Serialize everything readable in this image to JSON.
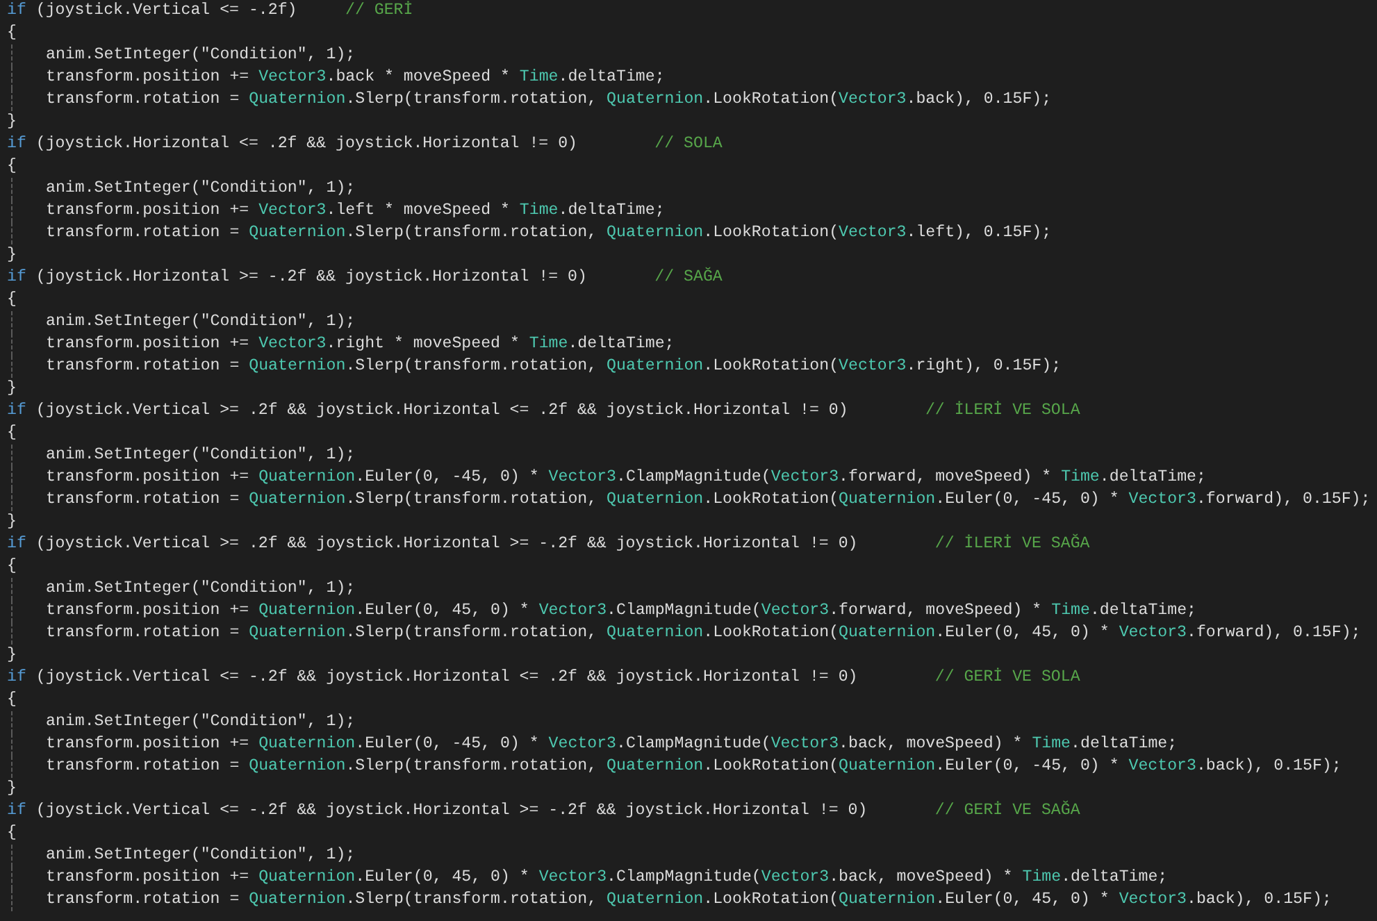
{
  "editor": {
    "lines": [
      {
        "indented": false,
        "tokens": [
          {
            "text": "if",
            "kind": "keyword"
          },
          {
            "text": " (joystick.Vertical <= -.2f)     ",
            "kind": "plain"
          },
          {
            "text": "// GERİ",
            "kind": "comment"
          }
        ]
      },
      {
        "indented": false,
        "tokens": [
          {
            "text": "{",
            "kind": "plain"
          }
        ]
      },
      {
        "indented": true,
        "tokens": [
          {
            "text": "anim.SetInteger(\"Condition\", 1);",
            "kind": "plain"
          }
        ]
      },
      {
        "indented": true,
        "tokens": [
          {
            "text": "transform.position += ",
            "kind": "plain"
          },
          {
            "text": "Vector3",
            "kind": "type"
          },
          {
            "text": ".back * moveSpeed * ",
            "kind": "plain"
          },
          {
            "text": "Time",
            "kind": "type"
          },
          {
            "text": ".deltaTime;",
            "kind": "plain"
          }
        ]
      },
      {
        "indented": true,
        "tokens": [
          {
            "text": "transform.rotation = ",
            "kind": "plain"
          },
          {
            "text": "Quaternion",
            "kind": "type"
          },
          {
            "text": ".Slerp(transform.rotation, ",
            "kind": "plain"
          },
          {
            "text": "Quaternion",
            "kind": "type"
          },
          {
            "text": ".LookRotation(",
            "kind": "plain"
          },
          {
            "text": "Vector3",
            "kind": "type"
          },
          {
            "text": ".back), 0.15F);",
            "kind": "plain"
          }
        ]
      },
      {
        "indented": false,
        "tokens": [
          {
            "text": "}",
            "kind": "plain"
          }
        ]
      },
      {
        "indented": false,
        "tokens": [
          {
            "text": "if",
            "kind": "keyword"
          },
          {
            "text": " (joystick.Horizontal <= .2f && joystick.Horizontal != 0)        ",
            "kind": "plain"
          },
          {
            "text": "// SOLA",
            "kind": "comment"
          }
        ]
      },
      {
        "indented": false,
        "tokens": [
          {
            "text": "{",
            "kind": "plain"
          }
        ]
      },
      {
        "indented": true,
        "tokens": [
          {
            "text": "anim.SetInteger(\"Condition\", 1);",
            "kind": "plain"
          }
        ]
      },
      {
        "indented": true,
        "tokens": [
          {
            "text": "transform.position += ",
            "kind": "plain"
          },
          {
            "text": "Vector3",
            "kind": "type"
          },
          {
            "text": ".left * moveSpeed * ",
            "kind": "plain"
          },
          {
            "text": "Time",
            "kind": "type"
          },
          {
            "text": ".deltaTime;",
            "kind": "plain"
          }
        ]
      },
      {
        "indented": true,
        "tokens": [
          {
            "text": "transform.rotation = ",
            "kind": "plain"
          },
          {
            "text": "Quaternion",
            "kind": "type"
          },
          {
            "text": ".Slerp(transform.rotation, ",
            "kind": "plain"
          },
          {
            "text": "Quaternion",
            "kind": "type"
          },
          {
            "text": ".LookRotation(",
            "kind": "plain"
          },
          {
            "text": "Vector3",
            "kind": "type"
          },
          {
            "text": ".left), 0.15F);",
            "kind": "plain"
          }
        ]
      },
      {
        "indented": false,
        "tokens": [
          {
            "text": "}",
            "kind": "plain"
          }
        ]
      },
      {
        "indented": false,
        "tokens": [
          {
            "text": "if",
            "kind": "keyword"
          },
          {
            "text": " (joystick.Horizontal >= -.2f && joystick.Horizontal != 0)       ",
            "kind": "plain"
          },
          {
            "text": "// SAĞA",
            "kind": "comment"
          }
        ]
      },
      {
        "indented": false,
        "tokens": [
          {
            "text": "{",
            "kind": "plain"
          }
        ]
      },
      {
        "indented": true,
        "tokens": [
          {
            "text": "anim.SetInteger(\"Condition\", 1);",
            "kind": "plain"
          }
        ]
      },
      {
        "indented": true,
        "tokens": [
          {
            "text": "transform.position += ",
            "kind": "plain"
          },
          {
            "text": "Vector3",
            "kind": "type"
          },
          {
            "text": ".right * moveSpeed * ",
            "kind": "plain"
          },
          {
            "text": "Time",
            "kind": "type"
          },
          {
            "text": ".deltaTime;",
            "kind": "plain"
          }
        ]
      },
      {
        "indented": true,
        "tokens": [
          {
            "text": "transform.rotation = ",
            "kind": "plain"
          },
          {
            "text": "Quaternion",
            "kind": "type"
          },
          {
            "text": ".Slerp(transform.rotation, ",
            "kind": "plain"
          },
          {
            "text": "Quaternion",
            "kind": "type"
          },
          {
            "text": ".LookRotation(",
            "kind": "plain"
          },
          {
            "text": "Vector3",
            "kind": "type"
          },
          {
            "text": ".right), 0.15F);",
            "kind": "plain"
          }
        ]
      },
      {
        "indented": false,
        "tokens": [
          {
            "text": "}",
            "kind": "plain"
          }
        ]
      },
      {
        "indented": false,
        "tokens": [
          {
            "text": "if",
            "kind": "keyword"
          },
          {
            "text": " (joystick.Vertical >= .2f && joystick.Horizontal <= .2f && joystick.Horizontal != 0)        ",
            "kind": "plain"
          },
          {
            "text": "// İLERİ VE SOLA",
            "kind": "comment"
          }
        ]
      },
      {
        "indented": false,
        "tokens": [
          {
            "text": "{",
            "kind": "plain"
          }
        ]
      },
      {
        "indented": true,
        "tokens": [
          {
            "text": "anim.SetInteger(\"Condition\", 1);",
            "kind": "plain"
          }
        ]
      },
      {
        "indented": true,
        "tokens": [
          {
            "text": "transform.position += ",
            "kind": "plain"
          },
          {
            "text": "Quaternion",
            "kind": "type"
          },
          {
            "text": ".Euler(0, -45, 0) * ",
            "kind": "plain"
          },
          {
            "text": "Vector3",
            "kind": "type"
          },
          {
            "text": ".ClampMagnitude(",
            "kind": "plain"
          },
          {
            "text": "Vector3",
            "kind": "type"
          },
          {
            "text": ".forward, moveSpeed) * ",
            "kind": "plain"
          },
          {
            "text": "Time",
            "kind": "type"
          },
          {
            "text": ".deltaTime;",
            "kind": "plain"
          }
        ]
      },
      {
        "indented": true,
        "tokens": [
          {
            "text": "transform.rotation = ",
            "kind": "plain"
          },
          {
            "text": "Quaternion",
            "kind": "type"
          },
          {
            "text": ".Slerp(transform.rotation, ",
            "kind": "plain"
          },
          {
            "text": "Quaternion",
            "kind": "type"
          },
          {
            "text": ".LookRotation(",
            "kind": "plain"
          },
          {
            "text": "Quaternion",
            "kind": "type"
          },
          {
            "text": ".Euler(0, -45, 0) * ",
            "kind": "plain"
          },
          {
            "text": "Vector3",
            "kind": "type"
          },
          {
            "text": ".forward), 0.15F);",
            "kind": "plain"
          }
        ]
      },
      {
        "indented": false,
        "tokens": [
          {
            "text": "}",
            "kind": "plain"
          }
        ]
      },
      {
        "indented": false,
        "tokens": [
          {
            "text": "if",
            "kind": "keyword"
          },
          {
            "text": " (joystick.Vertical >= .2f && joystick.Horizontal >= -.2f && joystick.Horizontal != 0)        ",
            "kind": "plain"
          },
          {
            "text": "// İLERİ VE SAĞA",
            "kind": "comment"
          }
        ]
      },
      {
        "indented": false,
        "tokens": [
          {
            "text": "{",
            "kind": "plain"
          }
        ]
      },
      {
        "indented": true,
        "tokens": [
          {
            "text": "anim.SetInteger(\"Condition\", 1);",
            "kind": "plain"
          }
        ]
      },
      {
        "indented": true,
        "tokens": [
          {
            "text": "transform.position += ",
            "kind": "plain"
          },
          {
            "text": "Quaternion",
            "kind": "type"
          },
          {
            "text": ".Euler(0, 45, 0) * ",
            "kind": "plain"
          },
          {
            "text": "Vector3",
            "kind": "type"
          },
          {
            "text": ".ClampMagnitude(",
            "kind": "plain"
          },
          {
            "text": "Vector3",
            "kind": "type"
          },
          {
            "text": ".forward, moveSpeed) * ",
            "kind": "plain"
          },
          {
            "text": "Time",
            "kind": "type"
          },
          {
            "text": ".deltaTime;",
            "kind": "plain"
          }
        ]
      },
      {
        "indented": true,
        "tokens": [
          {
            "text": "transform.rotation = ",
            "kind": "plain"
          },
          {
            "text": "Quaternion",
            "kind": "type"
          },
          {
            "text": ".Slerp(transform.rotation, ",
            "kind": "plain"
          },
          {
            "text": "Quaternion",
            "kind": "type"
          },
          {
            "text": ".LookRotation(",
            "kind": "plain"
          },
          {
            "text": "Quaternion",
            "kind": "type"
          },
          {
            "text": ".Euler(0, 45, 0) * ",
            "kind": "plain"
          },
          {
            "text": "Vector3",
            "kind": "type"
          },
          {
            "text": ".forward), 0.15F);",
            "kind": "plain"
          }
        ]
      },
      {
        "indented": false,
        "tokens": [
          {
            "text": "}",
            "kind": "plain"
          }
        ]
      },
      {
        "indented": false,
        "tokens": [
          {
            "text": "if",
            "kind": "keyword"
          },
          {
            "text": " (joystick.Vertical <= -.2f && joystick.Horizontal <= .2f && joystick.Horizontal != 0)        ",
            "kind": "plain"
          },
          {
            "text": "// GERİ VE SOLA",
            "kind": "comment"
          }
        ]
      },
      {
        "indented": false,
        "tokens": [
          {
            "text": "{",
            "kind": "plain"
          }
        ]
      },
      {
        "indented": true,
        "tokens": [
          {
            "text": "anim.SetInteger(\"Condition\", 1);",
            "kind": "plain"
          }
        ]
      },
      {
        "indented": true,
        "tokens": [
          {
            "text": "transform.position += ",
            "kind": "plain"
          },
          {
            "text": "Quaternion",
            "kind": "type"
          },
          {
            "text": ".Euler(0, -45, 0) * ",
            "kind": "plain"
          },
          {
            "text": "Vector3",
            "kind": "type"
          },
          {
            "text": ".ClampMagnitude(",
            "kind": "plain"
          },
          {
            "text": "Vector3",
            "kind": "type"
          },
          {
            "text": ".back, moveSpeed) * ",
            "kind": "plain"
          },
          {
            "text": "Time",
            "kind": "type"
          },
          {
            "text": ".deltaTime;",
            "kind": "plain"
          }
        ]
      },
      {
        "indented": true,
        "tokens": [
          {
            "text": "transform.rotation = ",
            "kind": "plain"
          },
          {
            "text": "Quaternion",
            "kind": "type"
          },
          {
            "text": ".Slerp(transform.rotation, ",
            "kind": "plain"
          },
          {
            "text": "Quaternion",
            "kind": "type"
          },
          {
            "text": ".LookRotation(",
            "kind": "plain"
          },
          {
            "text": "Quaternion",
            "kind": "type"
          },
          {
            "text": ".Euler(0, -45, 0) * ",
            "kind": "plain"
          },
          {
            "text": "Vector3",
            "kind": "type"
          },
          {
            "text": ".back), 0.15F);",
            "kind": "plain"
          }
        ]
      },
      {
        "indented": false,
        "tokens": [
          {
            "text": "}",
            "kind": "plain"
          }
        ]
      },
      {
        "indented": false,
        "tokens": [
          {
            "text": "if",
            "kind": "keyword"
          },
          {
            "text": " (joystick.Vertical <= -.2f && joystick.Horizontal >= -.2f && joystick.Horizontal != 0)       ",
            "kind": "plain"
          },
          {
            "text": "// GERİ VE SAĞA",
            "kind": "comment"
          }
        ]
      },
      {
        "indented": false,
        "tokens": [
          {
            "text": "{",
            "kind": "plain"
          }
        ]
      },
      {
        "indented": true,
        "tokens": [
          {
            "text": "anim.SetInteger(\"Condition\", 1);",
            "kind": "plain"
          }
        ]
      },
      {
        "indented": true,
        "tokens": [
          {
            "text": "transform.position += ",
            "kind": "plain"
          },
          {
            "text": "Quaternion",
            "kind": "type"
          },
          {
            "text": ".Euler(0, 45, 0) * ",
            "kind": "plain"
          },
          {
            "text": "Vector3",
            "kind": "type"
          },
          {
            "text": ".ClampMagnitude(",
            "kind": "plain"
          },
          {
            "text": "Vector3",
            "kind": "type"
          },
          {
            "text": ".back, moveSpeed) * ",
            "kind": "plain"
          },
          {
            "text": "Time",
            "kind": "type"
          },
          {
            "text": ".deltaTime;",
            "kind": "plain"
          }
        ]
      },
      {
        "indented": true,
        "tokens": [
          {
            "text": "transform.rotation = ",
            "kind": "plain"
          },
          {
            "text": "Quaternion",
            "kind": "type"
          },
          {
            "text": ".Slerp(transform.rotation, ",
            "kind": "plain"
          },
          {
            "text": "Quaternion",
            "kind": "type"
          },
          {
            "text": ".LookRotation(",
            "kind": "plain"
          },
          {
            "text": "Quaternion",
            "kind": "type"
          },
          {
            "text": ".Euler(0, 45, 0) * ",
            "kind": "plain"
          },
          {
            "text": "Vector3",
            "kind": "type"
          },
          {
            "text": ".back), 0.15F);",
            "kind": "plain"
          }
        ]
      }
    ]
  }
}
